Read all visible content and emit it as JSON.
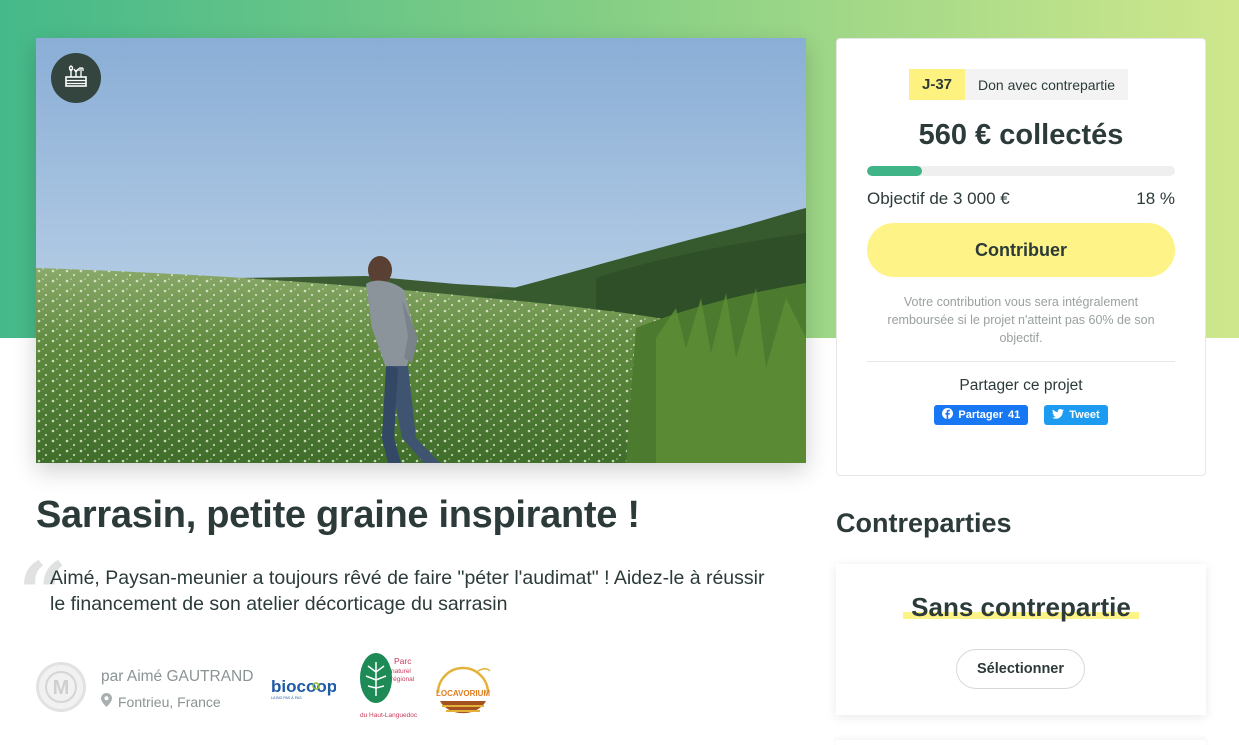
{
  "project": {
    "title": "Sarrasin, petite graine inspirante !",
    "description": "Aimé, Paysan-meunier a toujours rêvé de faire \"péter l'audimat\" ! Aidez-le à réussir le financement de son atelier décorticage du sarrasin",
    "quote_mark": "“",
    "category_icon": "agriculture-icon"
  },
  "author": {
    "name": "par Aimé GAUTRAND",
    "location": "Fontrieu, France",
    "avatar_letter": "M"
  },
  "partners": {
    "biocoop": {
      "name": "biocoop",
      "tagline": "LA BIO PAS À PAS",
      "color": "#1e5aa8",
      "accent": "#8dbf3b"
    },
    "parc": {
      "lines": [
        "Parc",
        "naturel",
        "régional",
        "du Haut-Languedoc"
      ],
      "color": "#c93a5a",
      "green": "#1e8a55"
    },
    "locavorium": {
      "name": "LOCAVORIUM",
      "color": "#e07f22"
    }
  },
  "funding": {
    "days_left": "J-37",
    "campaign_type": "Don avec contrepartie",
    "collected": "560 € collectés",
    "goal": "Objectif de 3 000 €",
    "percent_label": "18 %",
    "progress": 0.18,
    "contribute_label": "Contribuer",
    "refund_note": "Votre contribution vous sera intégralement remboursée si le projet n'atteint pas 60% de son objectif.",
    "share_title": "Partager ce projet",
    "facebook_label": "Partager",
    "facebook_count": "41",
    "tweet_label": "Tweet"
  },
  "rewards": {
    "heading": "Contreparties",
    "items": [
      {
        "title": "Sans contrepartie",
        "select_label": "Sélectionner"
      }
    ]
  },
  "colors": {
    "accent_green": "#3eb487",
    "accent_yellow": "#fdf386",
    "text_dark": "#2c3a3a",
    "facebook_blue": "#1877f2",
    "twitter_blue": "#1d9bf0"
  }
}
